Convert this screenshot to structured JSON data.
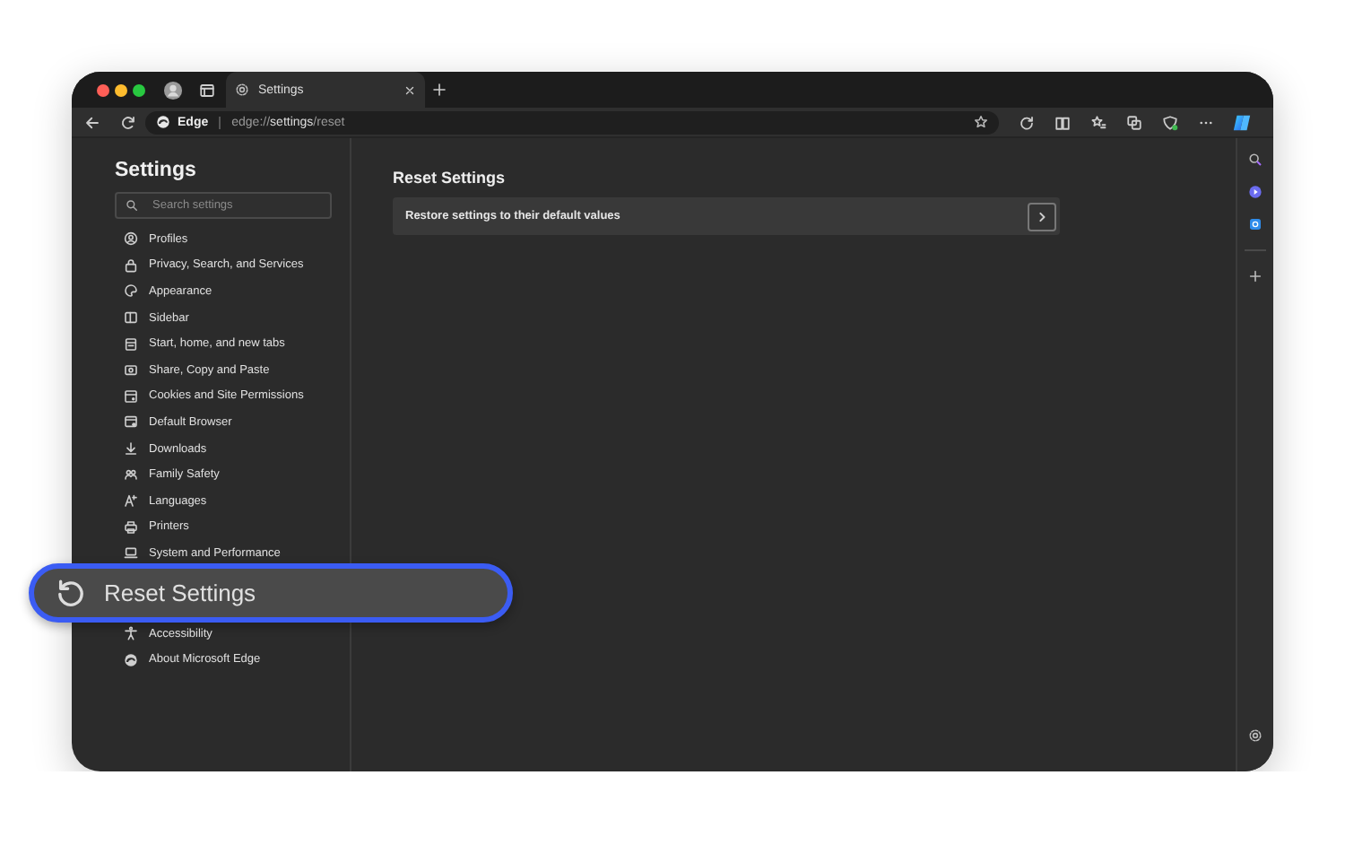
{
  "tab": {
    "title": "Settings",
    "selected": true
  },
  "address_bar": {
    "site_label": "Edge",
    "url": "edge://**settings**/reset"
  },
  "sidebar": {
    "title": "Settings",
    "search": {
      "placeholder": "Search settings"
    },
    "items": [
      {
        "label": "Profiles",
        "selected": false
      },
      {
        "label": "Privacy, Search, and Services",
        "selected": false
      },
      {
        "label": "Appearance",
        "selected": false
      },
      {
        "label": "Sidebar",
        "selected": false
      },
      {
        "label": "Start, home, and new tabs",
        "selected": false
      },
      {
        "label": "Share, Copy and Paste",
        "selected": false
      },
      {
        "label": "Cookies and Site Permissions",
        "selected": false
      },
      {
        "label": "Default Browser",
        "selected": false
      },
      {
        "label": "Downloads",
        "selected": false
      },
      {
        "label": "Family Safety",
        "selected": false
      },
      {
        "label": "Languages",
        "selected": false
      },
      {
        "label": "Printers",
        "selected": false
      },
      {
        "label": "System and Performance",
        "selected": false
      },
      {
        "label": "Reset Settings",
        "selected": true
      },
      {
        "label": "Accessibility",
        "selected": false
      },
      {
        "label": "About Microsoft Edge",
        "selected": false
      }
    ]
  },
  "main": {
    "heading": "Reset Settings",
    "rows": [
      {
        "label": "Restore settings to their default values"
      }
    ]
  }
}
